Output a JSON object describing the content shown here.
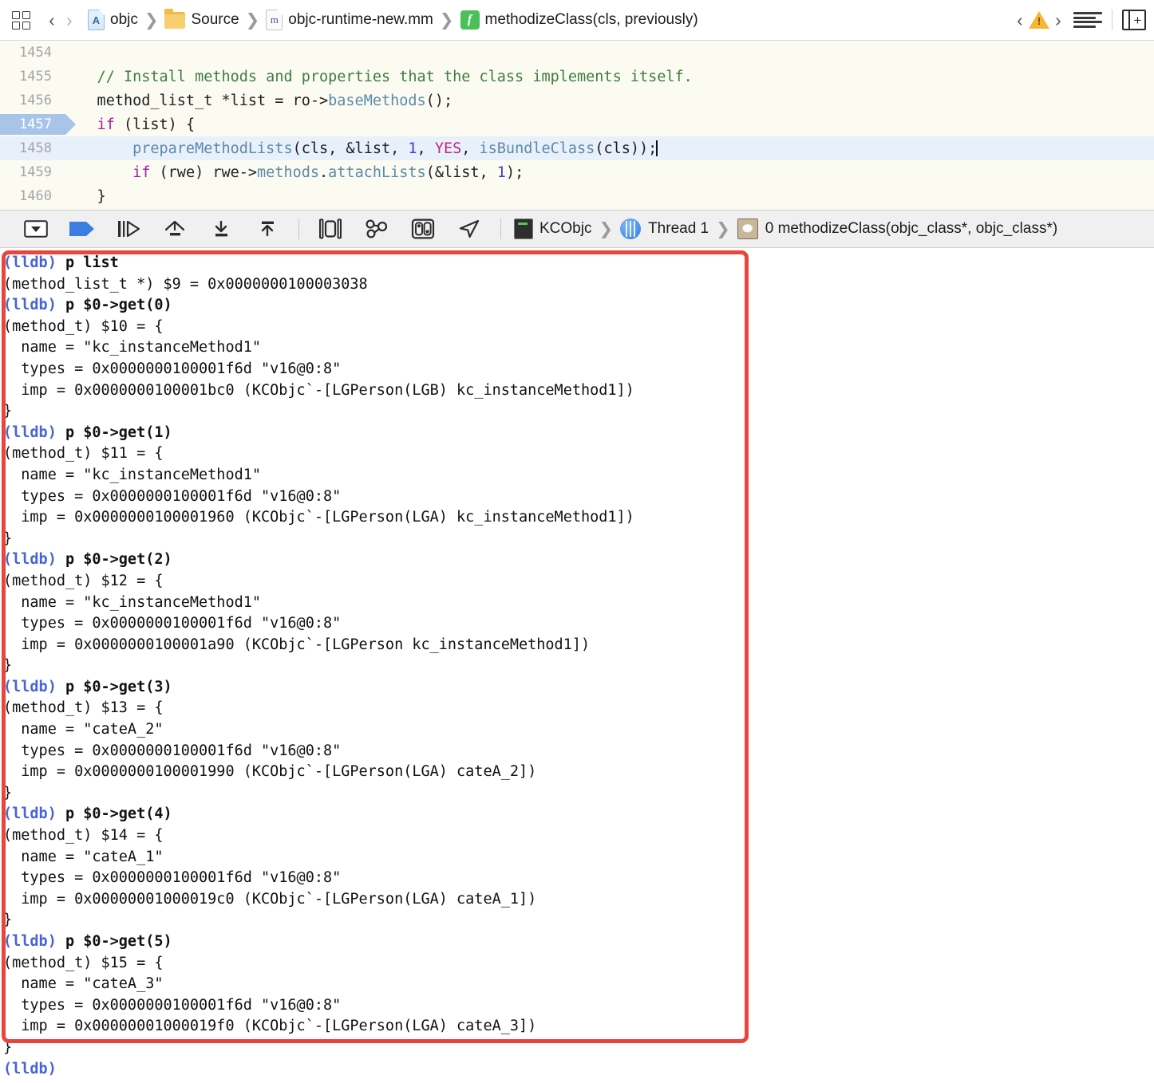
{
  "jumpbar": {
    "grid_icon": "grid-squares-icon",
    "back_label": "‹",
    "forward_label": "›",
    "breadcrumbs": [
      {
        "icon": "project-document-icon",
        "glyph": "A",
        "label": "objc"
      },
      {
        "icon": "folder-icon",
        "glyph": "",
        "label": "Source"
      },
      {
        "icon": "objc-file-icon",
        "glyph": "m",
        "label": "objc-runtime-new.mm"
      },
      {
        "icon": "function-icon",
        "glyph": "f",
        "label": "methodizeClass(cls, previously)"
      }
    ],
    "separator": "❯",
    "issue_prev": "‹",
    "issue_next": "›",
    "warning_icon": "warning-triangle-icon",
    "warning_glyph": "!",
    "minimap_icon": "minimap-lines-icon",
    "assistant_icon": "assistant-editor-add-icon",
    "assistant_glyph": "+"
  },
  "editor": {
    "lines": [
      {
        "num": "1454",
        "current": false,
        "highlight": false,
        "tokens": []
      },
      {
        "num": "1455",
        "current": false,
        "highlight": false,
        "tokens": [
          {
            "t": "plain",
            "v": "    "
          },
          {
            "t": "cmt",
            "v": "// Install methods and properties that the class implements itself."
          }
        ]
      },
      {
        "num": "1456",
        "current": false,
        "highlight": false,
        "tokens": [
          {
            "t": "plain",
            "v": "    method_list_t *list = ro->"
          },
          {
            "t": "fn",
            "v": "baseMethods"
          },
          {
            "t": "plain",
            "v": "();"
          }
        ]
      },
      {
        "num": "1457",
        "current": true,
        "highlight": false,
        "tokens": [
          {
            "t": "plain",
            "v": "    "
          },
          {
            "t": "kw",
            "v": "if"
          },
          {
            "t": "plain",
            "v": " (list) {"
          }
        ]
      },
      {
        "num": "1458",
        "current": false,
        "highlight": true,
        "tokens": [
          {
            "t": "plain",
            "v": "        "
          },
          {
            "t": "fn",
            "v": "prepareMethodLists"
          },
          {
            "t": "plain",
            "v": "(cls, &list, "
          },
          {
            "t": "num",
            "v": "1"
          },
          {
            "t": "plain",
            "v": ", "
          },
          {
            "t": "mac",
            "v": "YES"
          },
          {
            "t": "plain",
            "v": ", "
          },
          {
            "t": "fn",
            "v": "isBundleClass"
          },
          {
            "t": "plain",
            "v": "(cls));"
          },
          {
            "t": "caret",
            "v": ""
          }
        ]
      },
      {
        "num": "1459",
        "current": false,
        "highlight": false,
        "tokens": [
          {
            "t": "plain",
            "v": "        "
          },
          {
            "t": "kw",
            "v": "if"
          },
          {
            "t": "plain",
            "v": " (rwe) rwe->"
          },
          {
            "t": "fn",
            "v": "methods"
          },
          {
            "t": "plain",
            "v": "."
          },
          {
            "t": "fn",
            "v": "attachLists"
          },
          {
            "t": "plain",
            "v": "(&list, "
          },
          {
            "t": "num",
            "v": "1"
          },
          {
            "t": "plain",
            "v": ");"
          }
        ]
      },
      {
        "num": "1460",
        "current": false,
        "highlight": false,
        "tokens": [
          {
            "t": "plain",
            "v": "    }"
          }
        ]
      }
    ]
  },
  "debugbar": {
    "buttons": [
      {
        "name": "hide-debug-area-button",
        "icon": "panel-collapse-icon"
      },
      {
        "name": "continue-button",
        "icon": "continue-pennant-icon"
      },
      {
        "name": "step-over-button",
        "icon": "step-over-icon"
      },
      {
        "name": "step-into-button",
        "icon": "step-into-icon"
      },
      {
        "name": "step-out-button",
        "icon": "step-out-icon"
      },
      {
        "name": "step-out-of-block-button",
        "icon": "step-out-of-block-icon"
      },
      {
        "name": "view-debug-hierarchy-button",
        "icon": "view-hierarchy-icon"
      },
      {
        "name": "memory-graph-button",
        "icon": "memory-graph-icon"
      },
      {
        "name": "environment-overrides-button",
        "icon": "environment-overrides-icon"
      },
      {
        "name": "simulate-location-button",
        "icon": "location-arrow-icon"
      }
    ],
    "stack": {
      "process_icon": "process-icon",
      "process": "KCObjc",
      "thread_icon": "thread-icon",
      "thread": "Thread 1",
      "frame_icon": "stack-frame-icon",
      "frame": "0 methodizeClass(objc_class*, objc_class*)",
      "separator": "❯"
    }
  },
  "console": {
    "prompt": "(lldb)",
    "entries": [
      {
        "type": "cmd",
        "text": " p list"
      },
      {
        "type": "out",
        "text": "(method_list_t *) $9 = 0x0000000100003038"
      },
      {
        "type": "cmd",
        "text": " p $0->get(0)"
      },
      {
        "type": "out",
        "text": "(method_t) $10 = {"
      },
      {
        "type": "out",
        "text": "  name = \"kc_instanceMethod1\""
      },
      {
        "type": "out",
        "text": "  types = 0x0000000100001f6d \"v16@0:8\""
      },
      {
        "type": "out",
        "text": "  imp = 0x0000000100001bc0 (KCObjc`-[LGPerson(LGB) kc_instanceMethod1])"
      },
      {
        "type": "out",
        "text": "}"
      },
      {
        "type": "cmd",
        "text": " p $0->get(1)"
      },
      {
        "type": "out",
        "text": "(method_t) $11 = {"
      },
      {
        "type": "out",
        "text": "  name = \"kc_instanceMethod1\""
      },
      {
        "type": "out",
        "text": "  types = 0x0000000100001f6d \"v16@0:8\""
      },
      {
        "type": "out",
        "text": "  imp = 0x0000000100001960 (KCObjc`-[LGPerson(LGA) kc_instanceMethod1])"
      },
      {
        "type": "out",
        "text": "}"
      },
      {
        "type": "cmd",
        "text": " p $0->get(2)"
      },
      {
        "type": "out",
        "text": "(method_t) $12 = {"
      },
      {
        "type": "out",
        "text": "  name = \"kc_instanceMethod1\""
      },
      {
        "type": "out",
        "text": "  types = 0x0000000100001f6d \"v16@0:8\""
      },
      {
        "type": "out",
        "text": "  imp = 0x0000000100001a90 (KCObjc`-[LGPerson kc_instanceMethod1])"
      },
      {
        "type": "out",
        "text": "}"
      },
      {
        "type": "cmd",
        "text": " p $0->get(3)"
      },
      {
        "type": "out",
        "text": "(method_t) $13 = {"
      },
      {
        "type": "out",
        "text": "  name = \"cateA_2\""
      },
      {
        "type": "out",
        "text": "  types = 0x0000000100001f6d \"v16@0:8\""
      },
      {
        "type": "out",
        "text": "  imp = 0x0000000100001990 (KCObjc`-[LGPerson(LGA) cateA_2])"
      },
      {
        "type": "out",
        "text": "}"
      },
      {
        "type": "cmd",
        "text": " p $0->get(4)"
      },
      {
        "type": "out",
        "text": "(method_t) $14 = {"
      },
      {
        "type": "out",
        "text": "  name = \"cateA_1\""
      },
      {
        "type": "out",
        "text": "  types = 0x0000000100001f6d \"v16@0:8\""
      },
      {
        "type": "out",
        "text": "  imp = 0x00000001000019c0 (KCObjc`-[LGPerson(LGA) cateA_1])"
      },
      {
        "type": "out",
        "text": "}"
      },
      {
        "type": "cmd",
        "text": " p $0->get(5)"
      },
      {
        "type": "out",
        "text": "(method_t) $15 = {"
      },
      {
        "type": "out",
        "text": "  name = \"cateA_3\""
      },
      {
        "type": "out",
        "text": "  types = 0x0000000100001f6d \"v16@0:8\""
      },
      {
        "type": "out",
        "text": "  imp = 0x00000001000019f0 (KCObjc`-[LGPerson(LGA) cateA_3])"
      },
      {
        "type": "out",
        "text": "}"
      },
      {
        "type": "cmd",
        "text": ""
      }
    ],
    "annotation_color": "#e8453c"
  }
}
